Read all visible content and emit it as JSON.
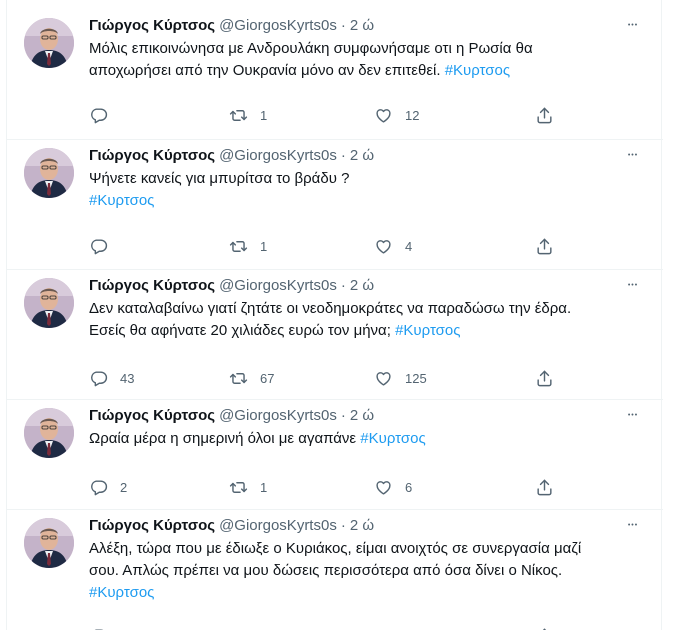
{
  "tweets": [
    {
      "name": "Γιώργος Κύρτσος",
      "handle": "@GiorgosKyrts0s",
      "time": "2 ώ",
      "lines": [
        [
          "Μόλις επικοινώνησα με Ανδρουλάκη συμφωνήσαμε οτι η Ρωσία θα",
          ""
        ],
        [
          "αποχωρήσει από την Ουκρανία μόνο αν δεν επιτεθεί. ",
          "#Κυρτσος"
        ]
      ],
      "reply_count": "",
      "retweet_count": "1",
      "like_count": "12"
    },
    {
      "name": "Γιώργος Κύρτσος",
      "handle": "@GiorgosKyrts0s",
      "time": "2 ώ",
      "lines": [
        [
          "Ψήνετε κανείς για μπυρίτσα το βράδυ ?",
          ""
        ],
        [
          "",
          "#Κυρτσος"
        ]
      ],
      "reply_count": "",
      "retweet_count": "1",
      "like_count": "4"
    },
    {
      "name": "Γιώργος Κύρτσος",
      "handle": "@GiorgosKyrts0s",
      "time": "2 ώ",
      "lines": [
        [
          "Δεν καταλαβαίνω γιατί ζητάτε οι νεοδημοκράτες να παραδώσω την έδρα.",
          ""
        ],
        [
          "Εσείς θα αφήνατε 20 χιλιάδες ευρώ τον μήνα; ",
          "#Κυρτσος"
        ]
      ],
      "reply_count": "43",
      "retweet_count": "67",
      "like_count": "125"
    },
    {
      "name": "Γιώργος Κύρτσος",
      "handle": "@GiorgosKyrts0s",
      "time": "2 ώ",
      "lines": [
        [
          "Ωραία μέρα η σημερινή όλοι με αγαπάνε  ",
          "#Κυρτσος"
        ]
      ],
      "reply_count": "2",
      "retweet_count": "1",
      "like_count": "6"
    },
    {
      "name": "Γιώργος Κύρτσος",
      "handle": "@GiorgosKyrts0s",
      "time": "2 ώ",
      "lines": [
        [
          "Αλέξη, τώρα που με έδιωξε ο Κυριάκος, είμαι ανοιχτός σε συνεργασία μαζί",
          ""
        ],
        [
          "σου. Απλώς πρέπει να μου δώσεις περισσότερα από όσα δίνει ο Νίκος.",
          ""
        ],
        [
          "",
          "#Κυρτσος"
        ]
      ],
      "reply_count": "",
      "retweet_count": "",
      "like_count": ""
    }
  ],
  "icons": {
    "more": "more-horizontal-icon",
    "reply": "reply-icon",
    "retweet": "retweet-icon",
    "like": "heart-icon",
    "share": "share-icon"
  },
  "colors": {
    "hashtag": "#1d9bf0",
    "secondary": "#536471",
    "divider": "#eff3f4"
  }
}
